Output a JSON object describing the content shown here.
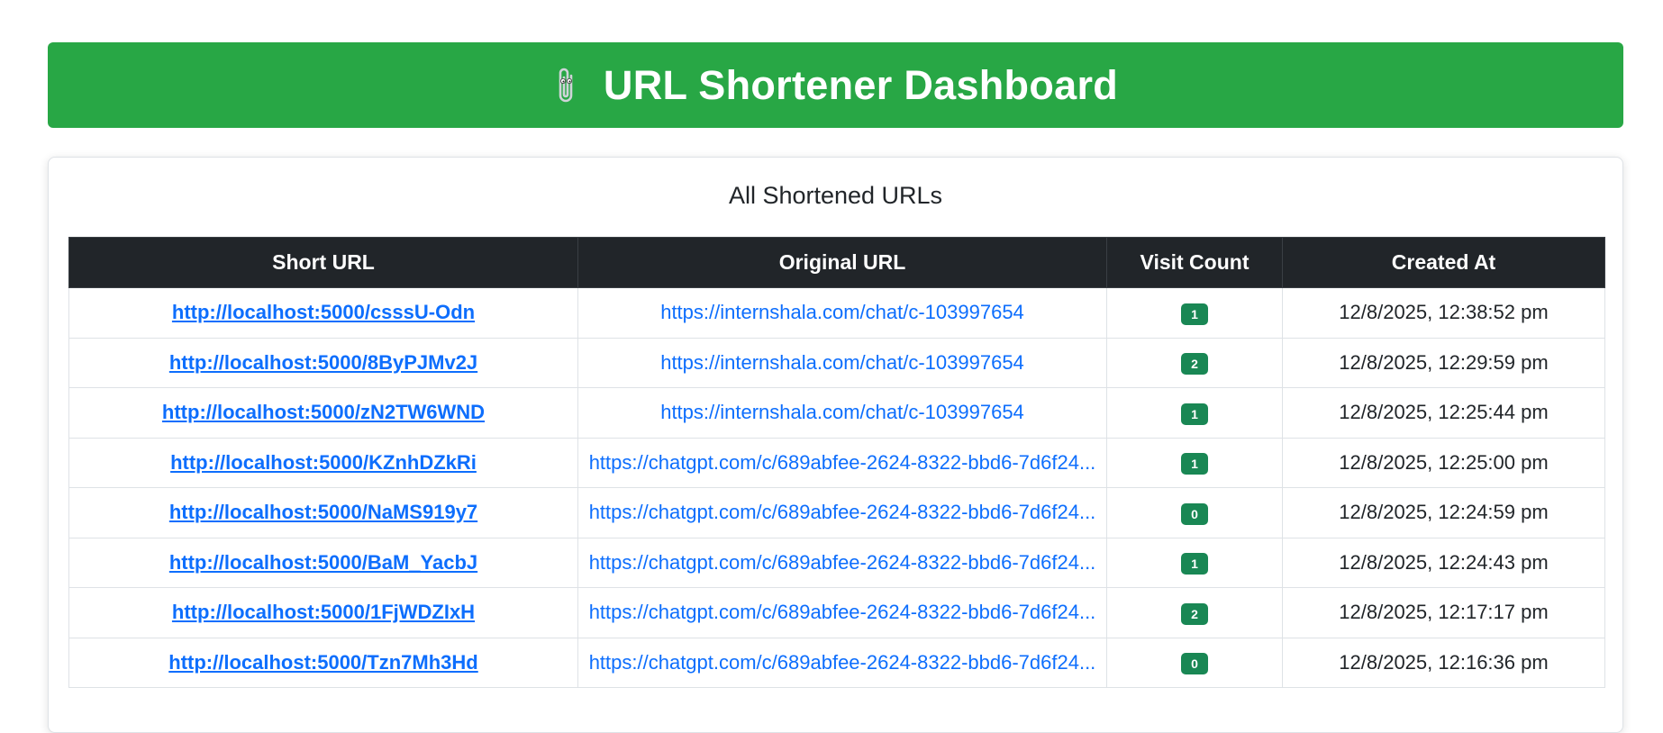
{
  "header": {
    "icon": "paperclip-icon",
    "title": "URL Shortener Dashboard",
    "bg_color": "#28a745"
  },
  "card": {
    "title": "All Shortened URLs"
  },
  "table": {
    "columns": [
      "Short URL",
      "Original URL",
      "Visit Count",
      "Created At"
    ],
    "rows": [
      {
        "short_url": "http://localhost:5000/csssU-Odn",
        "original_url": "https://internshala.com/chat/c-103997654",
        "visits": "1",
        "created_at": "12/8/2025, 12:38:52 pm"
      },
      {
        "short_url": "http://localhost:5000/8ByPJMv2J",
        "original_url": "https://internshala.com/chat/c-103997654",
        "visits": "2",
        "created_at": "12/8/2025, 12:29:59 pm"
      },
      {
        "short_url": "http://localhost:5000/zN2TW6WND",
        "original_url": "https://internshala.com/chat/c-103997654",
        "visits": "1",
        "created_at": "12/8/2025, 12:25:44 pm"
      },
      {
        "short_url": "http://localhost:5000/KZnhDZkRi",
        "original_url": "https://chatgpt.com/c/689abfee-2624-8322-bbd6-7d6f24...",
        "visits": "1",
        "created_at": "12/8/2025, 12:25:00 pm"
      },
      {
        "short_url": "http://localhost:5000/NaMS919y7",
        "original_url": "https://chatgpt.com/c/689abfee-2624-8322-bbd6-7d6f24...",
        "visits": "0",
        "created_at": "12/8/2025, 12:24:59 pm"
      },
      {
        "short_url": "http://localhost:5000/BaM_YacbJ",
        "original_url": "https://chatgpt.com/c/689abfee-2624-8322-bbd6-7d6f24...",
        "visits": "1",
        "created_at": "12/8/2025, 12:24:43 pm"
      },
      {
        "short_url": "http://localhost:5000/1FjWDZIxH",
        "original_url": "https://chatgpt.com/c/689abfee-2624-8322-bbd6-7d6f24...",
        "visits": "2",
        "created_at": "12/8/2025, 12:17:17 pm"
      },
      {
        "short_url": "http://localhost:5000/Tzn7Mh3Hd",
        "original_url": "https://chatgpt.com/c/689abfee-2624-8322-bbd6-7d6f24...",
        "visits": "0",
        "created_at": "12/8/2025, 12:16:36 pm"
      }
    ]
  },
  "colors": {
    "header_green": "#28a745",
    "link_blue": "#0d6efd",
    "badge_green": "#198754",
    "table_head": "#212529"
  }
}
